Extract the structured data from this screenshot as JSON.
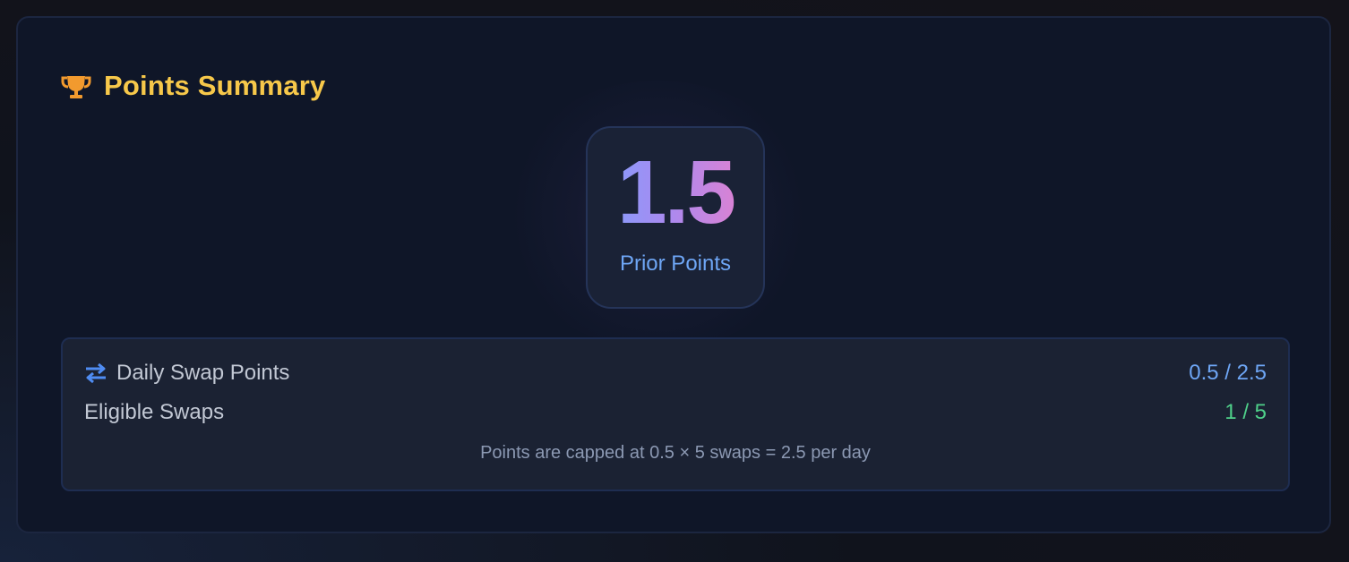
{
  "header": {
    "title": "Points Summary",
    "icon": "trophy-icon",
    "title_color": "#f7c84a"
  },
  "prior": {
    "value": "1.5",
    "label": "Prior Points"
  },
  "stats": {
    "daily_swap": {
      "icon": "swap-arrows-icon",
      "label": "Daily Swap Points",
      "value": "0.5 / 2.5",
      "value_color": "#6ea6f5"
    },
    "eligible_swaps": {
      "label": "Eligible Swaps",
      "value": "1 / 5",
      "value_color": "#4fd08a"
    },
    "note": "Points are capped at 0.5 × 5 swaps = 2.5 per day"
  }
}
